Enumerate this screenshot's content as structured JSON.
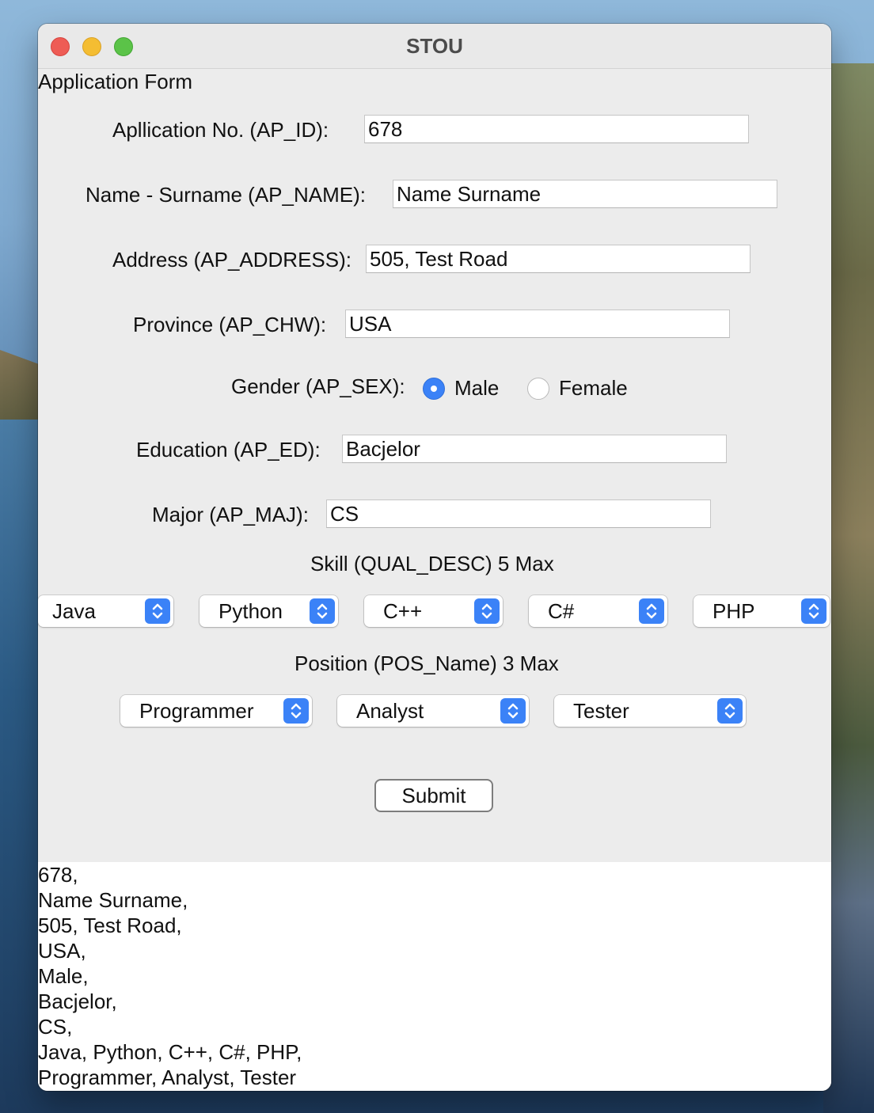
{
  "window": {
    "title": "STOU"
  },
  "form": {
    "heading": "Application Form",
    "app_no": {
      "label": "Apllication No. (AP_ID):",
      "value": "678"
    },
    "name": {
      "label": "Name - Surname (AP_NAME):",
      "value": "Name Surname"
    },
    "address": {
      "label": "Address (AP_ADDRESS):",
      "value": "505, Test Road"
    },
    "province": {
      "label": "Province (AP_CHW):",
      "value": "USA"
    },
    "gender": {
      "label": "Gender (AP_SEX):",
      "options": [
        "Male",
        "Female"
      ],
      "selected": "Male"
    },
    "education": {
      "label": "Education (AP_ED):",
      "value": "Bacjelor"
    },
    "major": {
      "label": "Major (AP_MAJ):",
      "value": "CS"
    },
    "skills": {
      "label": "Skill (QUAL_DESC) 5 Max",
      "selected": [
        "Java",
        "Python",
        "C++",
        "C#",
        "PHP"
      ]
    },
    "positions": {
      "label": "Position (POS_Name) 3 Max",
      "selected": [
        "Programmer",
        "Analyst",
        "Tester"
      ]
    },
    "submit_label": "Submit"
  },
  "output": {
    "lines": [
      "678,",
      "Name Surname,",
      "505, Test Road,",
      "USA,",
      "Male,",
      "Bacjelor,",
      "CS,",
      "Java, Python, C++, C#, PHP,",
      "Programmer, Analyst, Tester"
    ]
  },
  "colors": {
    "accent": "#3b82f7",
    "window_bg": "#ececec"
  },
  "icons": {
    "stepper": "chevron-up-down-icon"
  }
}
